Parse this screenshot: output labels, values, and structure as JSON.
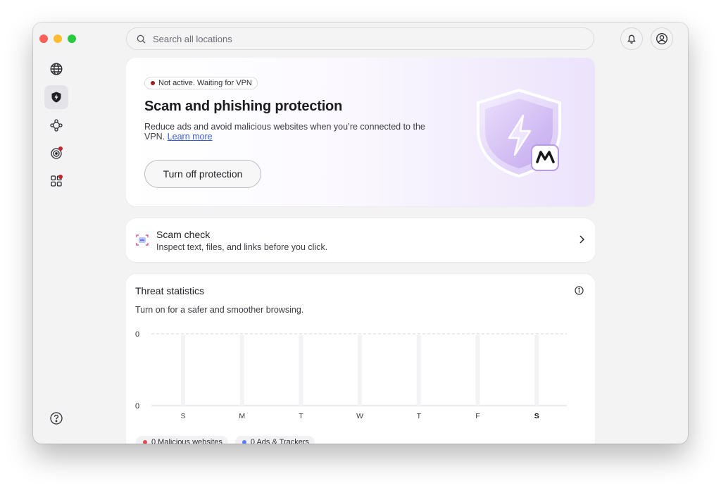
{
  "search": {
    "placeholder": "Search all locations"
  },
  "sidebar": {
    "items": [
      {
        "icon": "globe-icon"
      },
      {
        "icon": "shield-bolt-icon"
      },
      {
        "icon": "network-nodes-icon"
      },
      {
        "icon": "radar-icon"
      },
      {
        "icon": "apps-grid-icon"
      }
    ],
    "help_icon": "help-icon"
  },
  "header": {
    "notification_icon": "bell-icon",
    "account_icon": "user-icon"
  },
  "hero": {
    "status": "Not active. Waiting for VPN",
    "title": "Scam and phishing protection",
    "description": "Reduce ads and avoid malicious websites when you’re connected to the VPN.",
    "learn_more": "Learn more",
    "button": "Turn off protection"
  },
  "scam_check": {
    "title": "Scam check",
    "subtitle": "Inspect text, files, and links before you click."
  },
  "threat_stats": {
    "title": "Threat statistics",
    "subtitle": "Turn on for a safer and smoother browsing."
  },
  "chart_data": {
    "type": "bar",
    "categories": [
      "S",
      "M",
      "T",
      "W",
      "T",
      "F",
      "S"
    ],
    "series": [
      {
        "name": "Malicious websites",
        "values": [
          0,
          0,
          0,
          0,
          0,
          0,
          0
        ],
        "color": "#e5484d"
      },
      {
        "name": "Ads & Trackers",
        "values": [
          0,
          0,
          0,
          0,
          0,
          0,
          0
        ],
        "color": "#5b7cfa"
      }
    ],
    "y_tick_top": "0",
    "y_tick_bottom": "0",
    "ylim": [
      0,
      0
    ],
    "highlight_category_index": 6
  },
  "legend": [
    {
      "label": "0 Malicious websites",
      "color": "#e5484d"
    },
    {
      "label": "0 Ads & Trackers",
      "color": "#5b7cfa"
    }
  ]
}
